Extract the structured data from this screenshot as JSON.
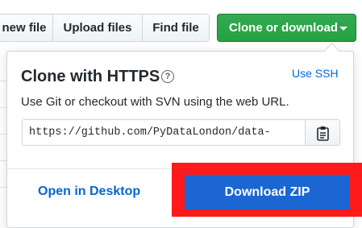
{
  "toolbar": {
    "new_file_label": "new file",
    "upload_files_label": "Upload files",
    "find_file_label": "Find file",
    "clone_label": "Clone or download"
  },
  "clone_panel": {
    "title": "Clone with HTTPS",
    "help_glyph": "?",
    "use_ssh_label": "Use SSH",
    "description": "Use Git or checkout with SVN using the web URL.",
    "url_value": "https://github.com/PyDataLondon/data-",
    "open_desktop_label": "Open in Desktop",
    "download_zip_label": "Download ZIP"
  },
  "colors": {
    "clone_button": "#28a745",
    "link_blue": "#0366d6",
    "download_zip": "#1b66d3",
    "highlight_red": "#ff1a1a"
  },
  "icons": {
    "help": "question-circle-icon",
    "copy": "clipboard-icon",
    "dropdown": "caret-down-icon"
  }
}
